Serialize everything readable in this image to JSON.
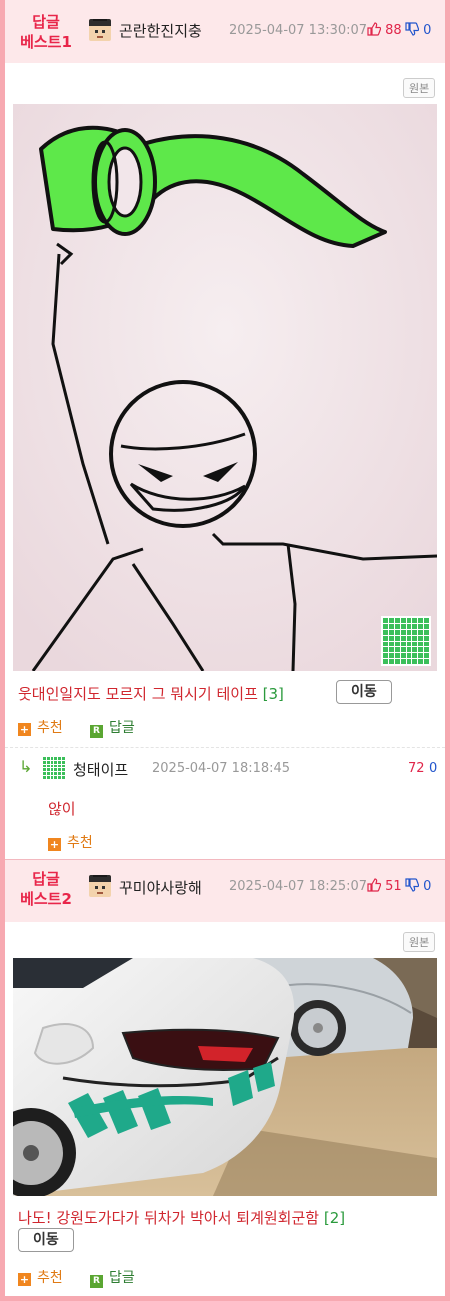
{
  "posts": [
    {
      "badge_line1": "답글",
      "badge_line2": "베스트1",
      "nick": "곤란한진지충",
      "date": "2025-04-07 13:30:07",
      "up": "88",
      "down": "0",
      "orig_label": "원본",
      "title": "웃대인일지도 모르지 그 뭐시기 테이프",
      "count": "[3]",
      "move_label": "이동",
      "rec_label": "추천",
      "reply_label": "답글"
    },
    {
      "badge_line1": "답글",
      "badge_line2": "베스트2",
      "nick": "꾸미야사랑해",
      "date": "2025-04-07 18:25:07",
      "up": "51",
      "down": "0",
      "orig_label": "원본",
      "title": "나도! 강원도가다가 뒤차가 박아서 퇴계원회군함",
      "count": "[2]",
      "move_label": "이동",
      "rec_label": "추천",
      "reply_label": "답글"
    }
  ],
  "reply": {
    "arrow": "↳",
    "nick": "청태이프",
    "date": "2025-04-07 18:18:45",
    "up": "72",
    "down": "0",
    "text": "않이",
    "rec_label": "추천"
  },
  "colors": {
    "frame_border": "#f7a9b1",
    "header_bg": "#fde8ea",
    "badge_red": "#e8264a",
    "title_red": "#d0272f",
    "count_green": "#2a9a3c",
    "rec_orange": "#e07a14",
    "reply_green": "#2e7d32",
    "tape_green": "#5ee84a"
  },
  "icons": [
    "thumbs-up-icon",
    "thumbs-down-icon",
    "plus-icon",
    "reply-r-icon",
    "reply-arrow-icon",
    "pixel-grid-icon",
    "pixel-avatar-icon"
  ]
}
